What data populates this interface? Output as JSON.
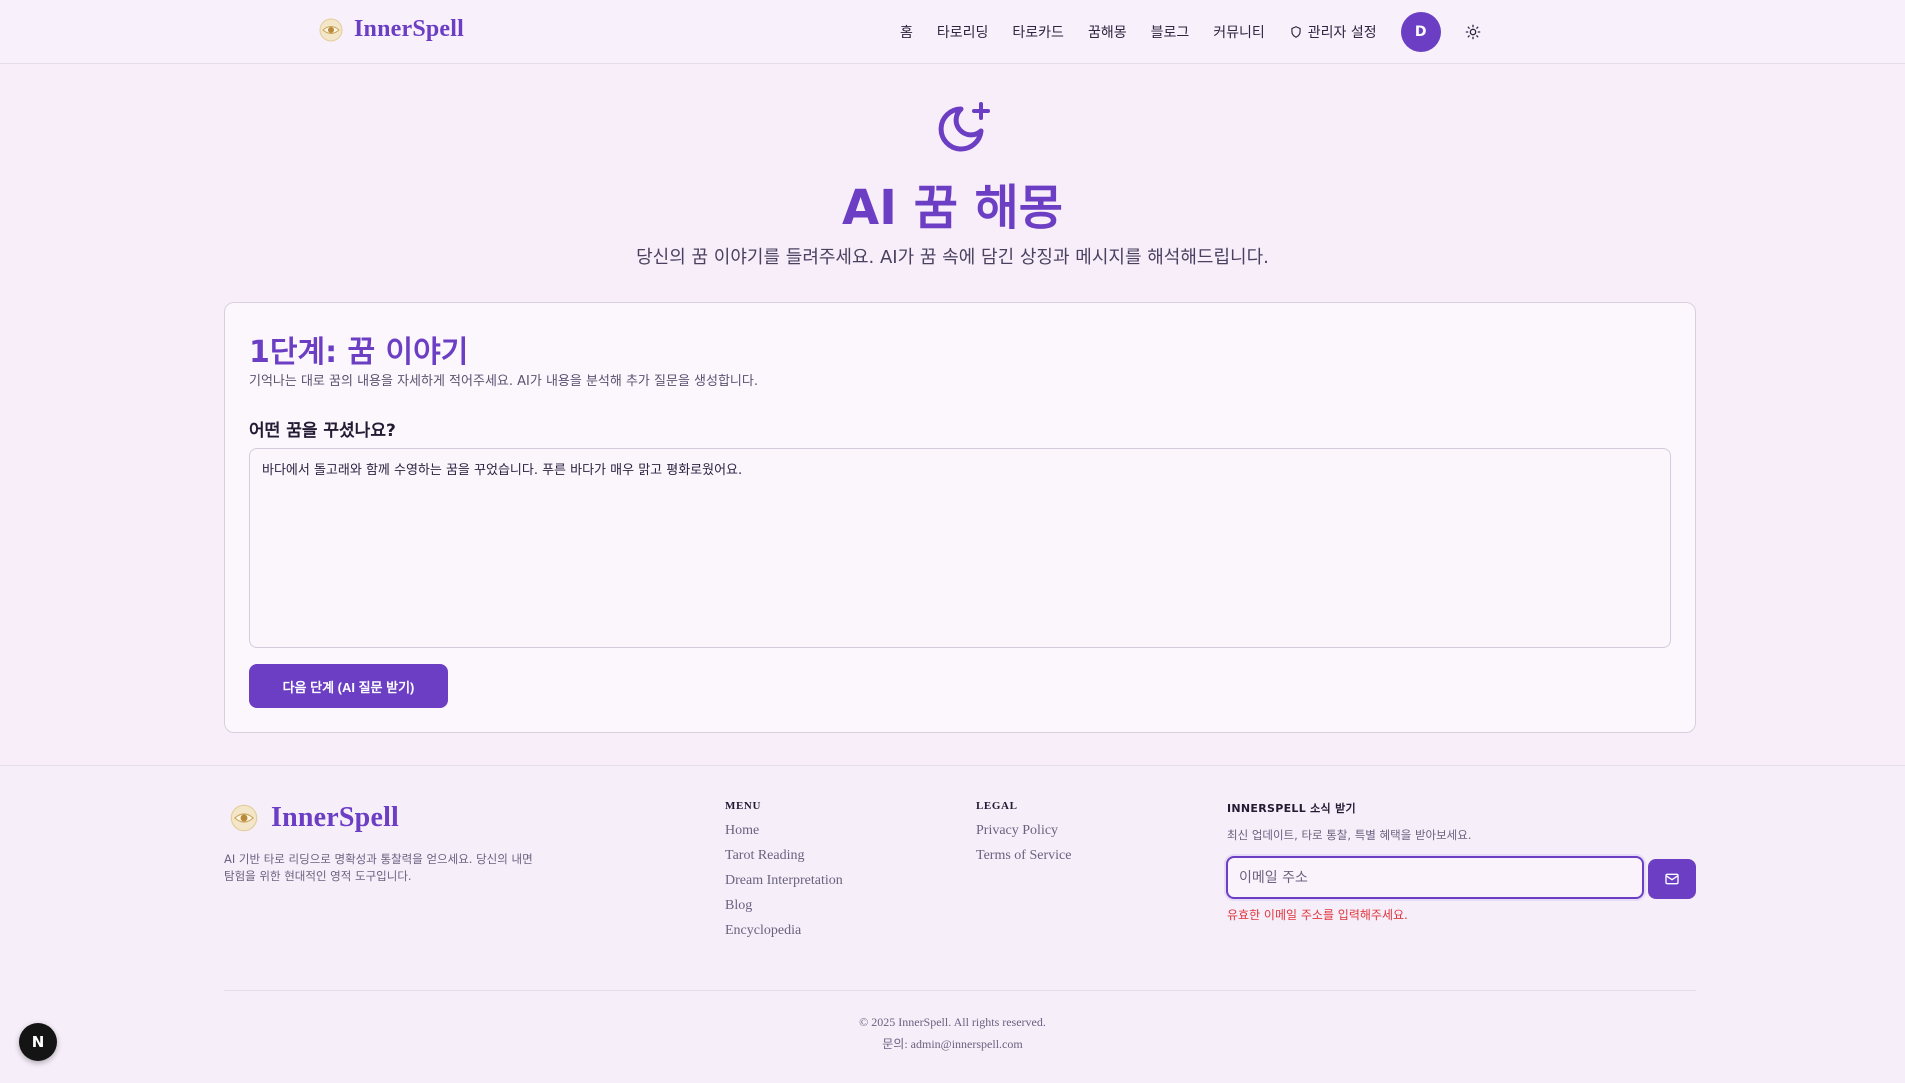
{
  "brand": {
    "name": "InnerSpell"
  },
  "nav": {
    "items": [
      {
        "label": "홈"
      },
      {
        "label": "타로리딩"
      },
      {
        "label": "타로카드"
      },
      {
        "label": "꿈해몽"
      },
      {
        "label": "블로그"
      },
      {
        "label": "커뮤니티"
      }
    ],
    "admin_label": "관리자 설정",
    "avatar_initial": "D"
  },
  "hero": {
    "title": "AI 꿈 해몽",
    "subtitle": "당신의 꿈 이야기를 들려주세요. AI가 꿈 속에 담긴 상징과 메시지를 해석해드립니다."
  },
  "step": {
    "title": "1단계: 꿈 이야기",
    "description": "기억나는 대로 꿈의 내용을 자세하게 적어주세요. AI가 내용을 분석해 추가 질문을 생성합니다.",
    "field_label": "어떤 꿈을 꾸셨나요?",
    "dream_text": "바다에서 돌고래와 함께 수영하는 꿈을 꾸었습니다. 푸른 바다가 매우 맑고 평화로웠어요.",
    "next_button": "다음 단계 (AI 질문 받기)"
  },
  "footer": {
    "description": "AI 기반 타로 리딩으로 명확성과 통찰력을 얻으세요. 당신의 내면 탐험을 위한 현대적인 영적 도구입니다.",
    "menu_title": "MENU",
    "menu_links": [
      {
        "label": "Home"
      },
      {
        "label": "Tarot Reading"
      },
      {
        "label": "Dream Interpretation"
      },
      {
        "label": "Blog"
      },
      {
        "label": "Encyclopedia"
      }
    ],
    "legal_title": "LEGAL",
    "legal_links": [
      {
        "label": "Privacy Policy"
      },
      {
        "label": "Terms of Service"
      }
    ],
    "newsletter_title": "INNERSPELL 소식 받기",
    "newsletter_desc": "최신 업데이트, 타로 통찰, 특별 혜택을 받아보세요.",
    "email_placeholder": "이메일 주소",
    "email_error": "유효한 이메일 주소를 입력해주세요.",
    "copyright": "© 2025 InnerSpell. All rights reserved.",
    "contact": "문의: admin@innerspell.com"
  },
  "dev_badge": "N",
  "colors": {
    "accent": "#6b3ec4",
    "background": "#f7eefa",
    "error": "#e0363d"
  }
}
